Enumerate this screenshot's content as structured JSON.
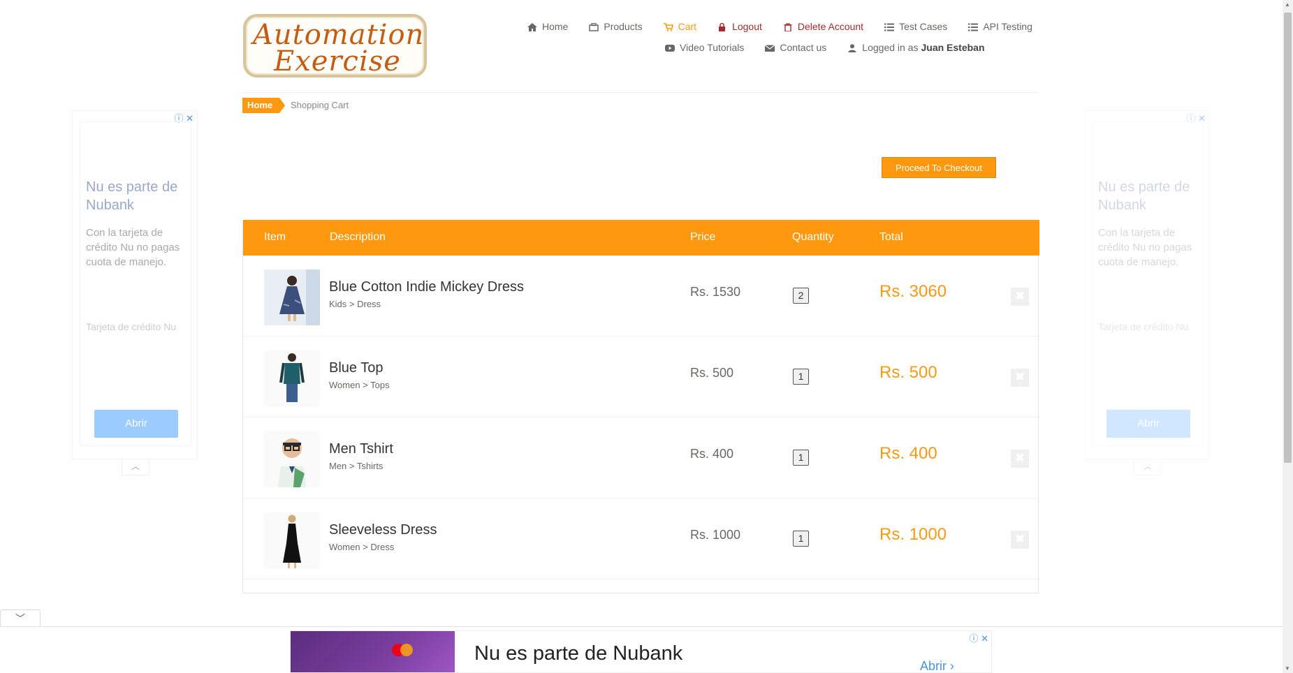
{
  "logo": {
    "line1": "Automation",
    "line2": "Exercise"
  },
  "nav": {
    "row1": [
      {
        "label": "Home",
        "icon": "home-icon",
        "name": "home"
      },
      {
        "label": "Products",
        "icon": "products-icon",
        "name": "products"
      },
      {
        "label": "Cart",
        "icon": "cart-icon",
        "name": "cart",
        "state": "active"
      },
      {
        "label": "Logout",
        "icon": "lock-icon",
        "name": "logout"
      },
      {
        "label": "Delete Account",
        "icon": "trash-icon",
        "name": "delete-account"
      },
      {
        "label": "Test Cases",
        "icon": "list-icon",
        "name": "test-cases"
      },
      {
        "label": "API Testing",
        "icon": "list-icon",
        "name": "api-testing"
      }
    ],
    "row2": [
      {
        "label": "Video Tutorials",
        "icon": "youtube-icon",
        "name": "video-tutorials"
      },
      {
        "label": "Contact us",
        "icon": "envelope-icon",
        "name": "contact-us"
      }
    ],
    "logged_in_prefix": "Logged in as",
    "logged_in_user": "Juan Esteban"
  },
  "breadcrumb": {
    "home": "Home",
    "current": "Shopping Cart"
  },
  "checkout_label": "Proceed To Checkout",
  "cart": {
    "headers": {
      "item": "Item",
      "description": "Description",
      "price": "Price",
      "quantity": "Quantity",
      "total": "Total"
    },
    "rows": [
      {
        "name": "Blue Cotton Indie Mickey Dress",
        "category": "Kids > Dress",
        "price": "Rs. 1530",
        "quantity": "2",
        "total": "Rs. 3060"
      },
      {
        "name": "Blue Top",
        "category": "Women > Tops",
        "price": "Rs. 500",
        "quantity": "1",
        "total": "Rs. 500"
      },
      {
        "name": "Men Tshirt",
        "category": "Men > Tshirts",
        "price": "Rs. 400",
        "quantity": "1",
        "total": "Rs. 400"
      },
      {
        "name": "Sleeveless Dress",
        "category": "Women > Dress",
        "price": "Rs. 1000",
        "quantity": "1",
        "total": "Rs. 1000"
      }
    ]
  },
  "side_ad": {
    "title": "Nu es parte de Nubank",
    "body": "Con la tarjeta de crédito Nu no pagas cuota de manejo.",
    "small": "Tarjeta de crédito Nu",
    "button": "Abrir"
  },
  "bottom_ad": {
    "title": "Nu es parte de Nubank",
    "button": "Abrir"
  },
  "colors": {
    "accent": "#FE980F",
    "danger": "#a52a2a"
  }
}
